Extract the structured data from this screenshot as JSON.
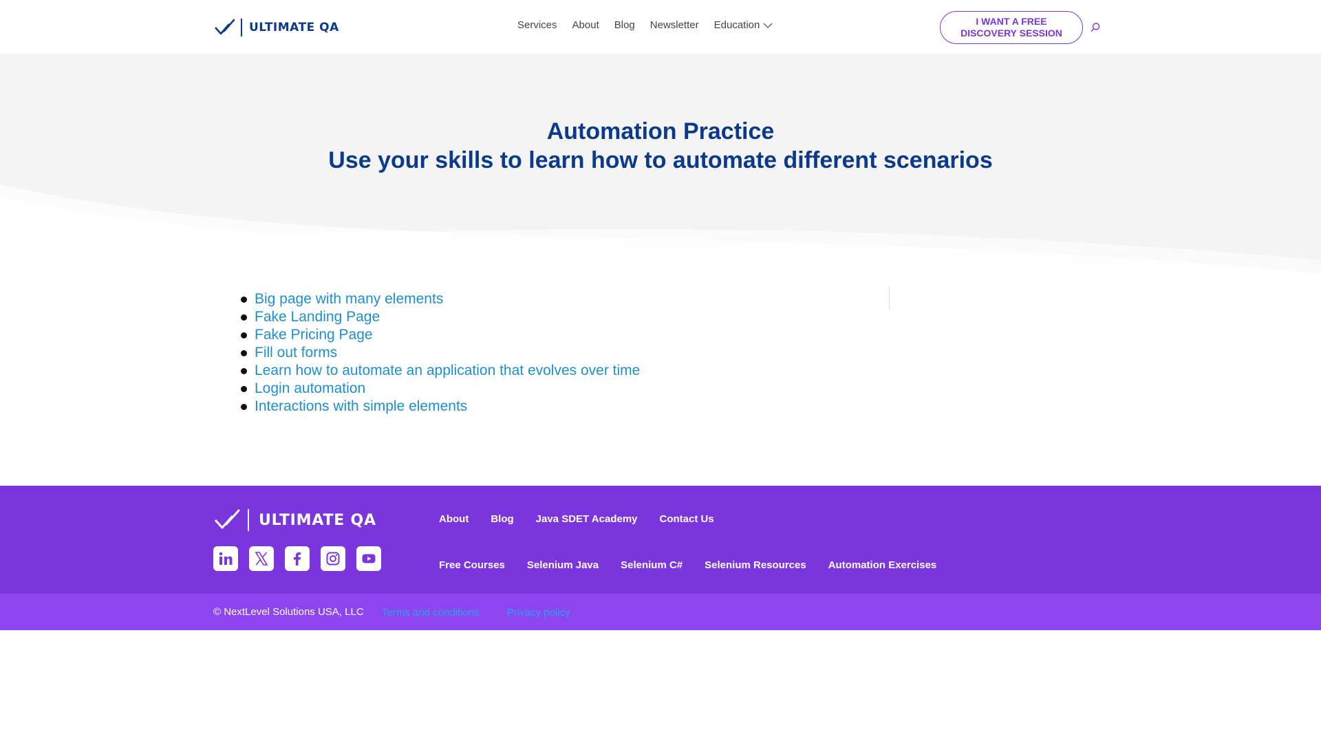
{
  "header": {
    "logo_text": "ULTIMATE QA",
    "nav": [
      {
        "label": "Services"
      },
      {
        "label": "About"
      },
      {
        "label": "Blog"
      },
      {
        "label": "Newsletter"
      },
      {
        "label": "Education"
      }
    ],
    "cta_line1": "I WANT A FREE",
    "cta_line2": "DISCOVERY SESSION"
  },
  "hero": {
    "title": "Automation Practice",
    "subtitle": "Use your skills to learn how to automate different scenarios"
  },
  "links": [
    {
      "label": "Big page with many elements"
    },
    {
      "label": "Fake Landing Page"
    },
    {
      "label": "Fake Pricing Page"
    },
    {
      "label": "Fill out forms"
    },
    {
      "label": "Learn how to automate an application that evolves over time"
    },
    {
      "label": "Login automation"
    },
    {
      "label": "Interactions with simple elements"
    }
  ],
  "footer": {
    "logo_text": "ULTIMATE QA",
    "socials": [
      "linkedin-icon",
      "x-icon",
      "facebook-icon",
      "instagram-icon",
      "youtube-icon"
    ],
    "row1": [
      {
        "label": "About"
      },
      {
        "label": "Blog"
      },
      {
        "label": "Java SDET Academy"
      },
      {
        "label": "Contact Us"
      }
    ],
    "row2": [
      {
        "label": "Free Courses"
      },
      {
        "label": "Selenium Java"
      },
      {
        "label": "Selenium C#"
      },
      {
        "label": "Selenium Resources"
      },
      {
        "label": "Automation Exercises"
      }
    ],
    "copyright": "© NextLevel Solutions USA, LLC",
    "terms": "Terms and conditions",
    "privacy": "Privacy policy"
  },
  "colors": {
    "brand_blue": "#0b3a8c",
    "purple": "#7b35dd",
    "link_blue": "#1a8fd4"
  }
}
